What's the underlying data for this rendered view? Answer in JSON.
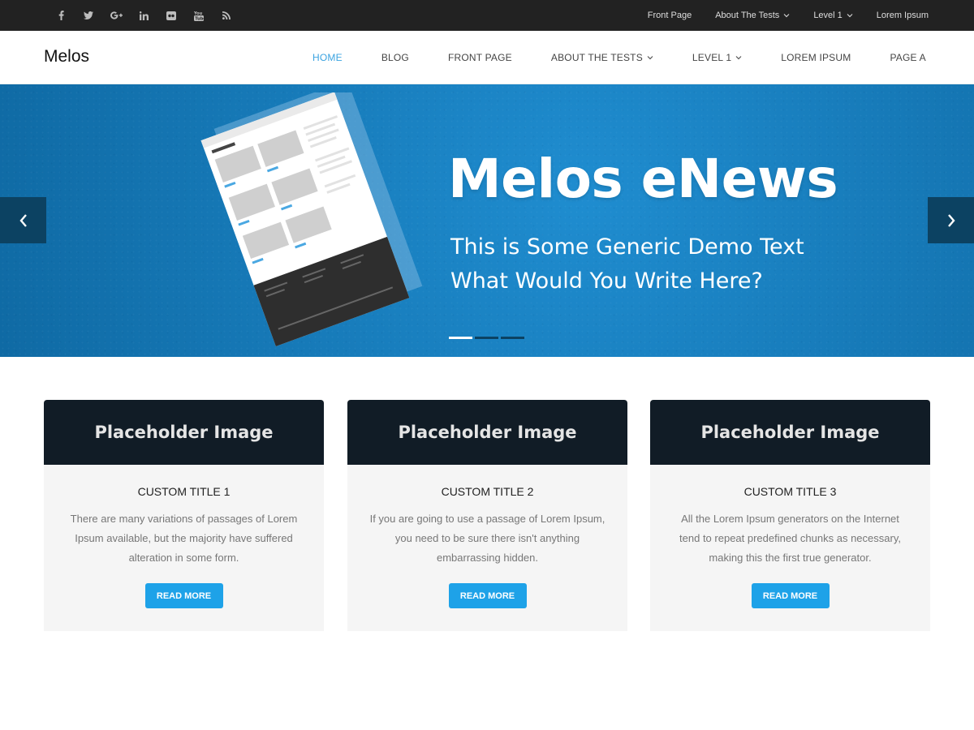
{
  "topbar": {
    "social_icons": [
      "facebook-icon",
      "twitter-icon",
      "google-plus-icon",
      "linkedin-icon",
      "flickr-icon",
      "youtube-icon",
      "rss-icon"
    ],
    "menu": [
      {
        "label": "Front Page"
      },
      {
        "label": "About The Tests",
        "has_dropdown": true
      },
      {
        "label": "Level 1",
        "has_dropdown": true
      },
      {
        "label": "Lorem Ipsum"
      }
    ]
  },
  "header": {
    "brand": "Melos",
    "nav": [
      {
        "label": "HOME",
        "active": true
      },
      {
        "label": "BLOG"
      },
      {
        "label": "FRONT PAGE"
      },
      {
        "label": "ABOUT THE TESTS",
        "has_dropdown": true
      },
      {
        "label": "LEVEL 1",
        "has_dropdown": true
      },
      {
        "label": "LOREM IPSUM"
      },
      {
        "label": "PAGE A"
      }
    ]
  },
  "hero": {
    "title": "Melos eNews",
    "subtitle_line1": "This is Some Generic Demo Text",
    "subtitle_line2": "What Would You Write Here?",
    "prev_icon": "chevron-left-icon",
    "next_icon": "chevron-right-icon",
    "slide_count": 3,
    "active_slide": 1
  },
  "cards": [
    {
      "image_label": "Placeholder Image",
      "title": "CUSTOM TITLE 1",
      "text": "There are many variations of passages of Lorem Ipsum available, but the majority have suffered alteration in some form.",
      "button": "READ MORE"
    },
    {
      "image_label": "Placeholder Image",
      "title": "CUSTOM TITLE 2",
      "text": "If you are going to use a passage of Lorem Ipsum, you need to be sure there isn't anything embarrassing hidden.",
      "button": "READ MORE"
    },
    {
      "image_label": "Placeholder Image",
      "title": "CUSTOM TITLE 3",
      "text": "All the Lorem Ipsum generators on the Internet tend to repeat predefined chunks as necessary, making this the first true generator.",
      "button": "READ MORE"
    }
  ],
  "colors": {
    "topbar_bg": "#222222",
    "accent": "#3ba3e0",
    "hero_bg": "#1679b7",
    "button_bg": "#1ea2e8",
    "card_header_bg": "#111c26"
  }
}
